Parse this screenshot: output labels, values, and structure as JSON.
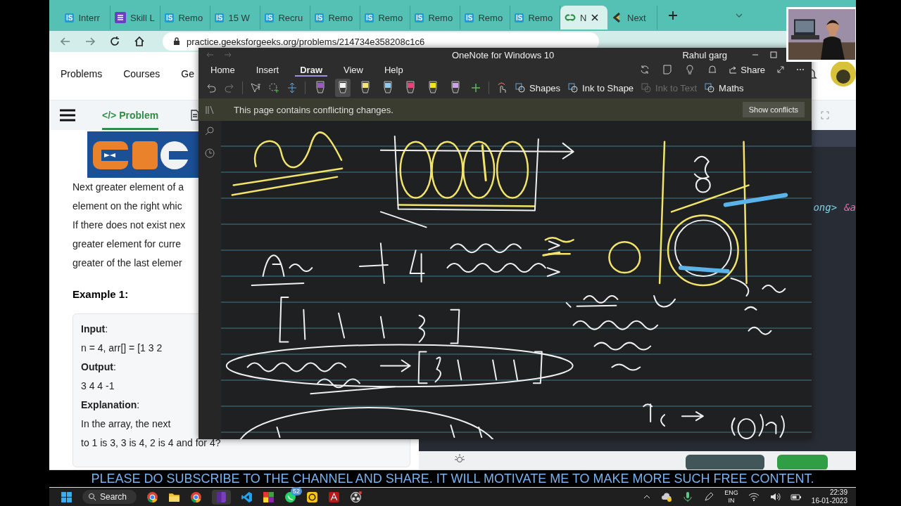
{
  "browser": {
    "tabs": [
      {
        "kind": "badge",
        "favicon": "IS",
        "label": "Interr",
        "selected": false
      },
      {
        "kind": "list",
        "label": "Skill L",
        "selected": false
      },
      {
        "kind": "badge",
        "favicon": "IS",
        "label": "Remo",
        "selected": false
      },
      {
        "kind": "badge",
        "favicon": "IS",
        "label": "15 W",
        "selected": false
      },
      {
        "kind": "badge",
        "favicon": "IS",
        "label": "Recru",
        "selected": false
      },
      {
        "kind": "badge",
        "favicon": "IS",
        "label": "Remo",
        "selected": false
      },
      {
        "kind": "badge",
        "favicon": "IS",
        "label": "Remo",
        "selected": false
      },
      {
        "kind": "badge",
        "favicon": "IS",
        "label": "Remo",
        "selected": false
      },
      {
        "kind": "badge",
        "favicon": "IS",
        "label": "Remo",
        "selected": false
      },
      {
        "kind": "badge",
        "favicon": "IS",
        "label": "Remo",
        "selected": false
      },
      {
        "kind": "gfg",
        "label": "N",
        "selected": true
      },
      {
        "kind": "next",
        "label": "Next",
        "selected": false
      }
    ],
    "address": "practice.geeksforgeeks.org/problems/214734e358208c1c6",
    "nav": [
      "Problems",
      "Courses",
      "Ge"
    ],
    "problem_tab": {
      "icon": "</>",
      "label": "Problem",
      "selected": true
    },
    "description": [
      "Next greater element of a",
      "element on the right whic",
      "If there does not exist nex",
      "greater element for curre",
      "greater of the last elemer"
    ],
    "example_title": "Example 1:",
    "example": [
      {
        "text": "**Input**:"
      },
      {
        "text": "n = 4, arr[] = [1 3 2"
      },
      {
        "text": "**Output**:"
      },
      {
        "text": "3 4 4 -1"
      },
      {
        "text": "**Explanation**:"
      },
      {
        "text": "In the array, the next"
      },
      {
        "text": "to 1 is 3, 3 is 4, 2 is 4 and for 4?"
      }
    ],
    "code": [
      {
        "text": "ong>",
        "color": "#7fd3e6"
      },
      {
        "text": "&a",
        "color": "#e06fb0"
      }
    ]
  },
  "onenote": {
    "title": "OneNote for Windows 10",
    "user": "Rahul garg",
    "share": "Share",
    "menu": [
      {
        "label": "Home",
        "selected": false
      },
      {
        "label": "Insert",
        "selected": false
      },
      {
        "label": "Draw",
        "selected": true
      },
      {
        "label": "View",
        "selected": false
      },
      {
        "label": "Help",
        "selected": false
      }
    ],
    "pens": [
      {
        "color": "#9b59c6",
        "selected": false
      },
      {
        "color": "#f2f2f2",
        "selected": true
      },
      {
        "color": "#f3e37a",
        "selected": false
      },
      {
        "color": "#8ecbf0",
        "selected": false
      },
      {
        "color": "#e2457a",
        "selected": false
      },
      {
        "color": "#f5e31c",
        "selected": false
      },
      {
        "color": "#c9a5e8",
        "selected": false
      }
    ],
    "tools": [
      {
        "label": "Shapes",
        "disabled": false
      },
      {
        "label": "Ink to Shape",
        "disabled": false
      },
      {
        "label": "Ink to Text",
        "disabled": true
      },
      {
        "label": "Maths",
        "disabled": false
      }
    ],
    "notice": "This page contains conflicting changes.",
    "notice_button": "Show conflicts"
  },
  "banner": "PLEASE DO SUBSCRIBE TO THE CHANNEL AND SHARE. IT WILL MOTIVATE ME TO MAKE MORE SUCH FREE CONTENT.",
  "taskbar": {
    "search": "Search",
    "chat_badge": "52",
    "language": [
      "ENG",
      "IN"
    ],
    "time": "22:39",
    "date": "16-01-2023"
  }
}
